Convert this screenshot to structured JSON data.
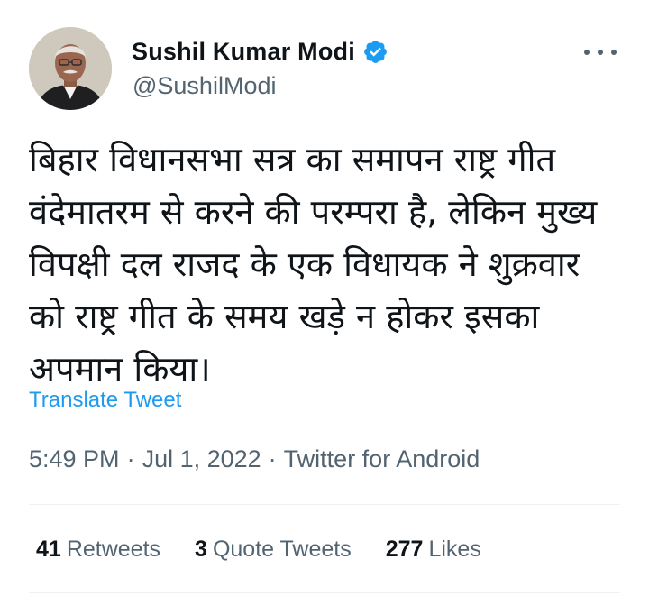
{
  "author": {
    "display_name": "Sushil Kumar Modi",
    "handle": "@SushilModi",
    "verified": true,
    "verified_icon": "verified-badge-icon",
    "accent_color": "#1d9bf0"
  },
  "tweet": {
    "text": "बिहार विधानसभा सत्र का समापन राष्ट्र गीत वंदेमातरम से करने की परम्परा है, लेकिन मुख्य विपक्षी दल राजद के एक विधायक ने शुक्रवार को राष्ट्र गीत के समय खड़े न होकर इसका अपमान किया।",
    "translate_label": "Translate Tweet"
  },
  "meta": {
    "time": "5:49 PM",
    "separator": "·",
    "date": "Jul 1, 2022",
    "source": "Twitter for Android"
  },
  "stats": {
    "retweets_count": "41",
    "retweets_label": "Retweets",
    "quotes_count": "3",
    "quotes_label": "Quote Tweets",
    "likes_count": "277",
    "likes_label": "Likes"
  },
  "icons": {
    "more": "more-options-icon"
  }
}
